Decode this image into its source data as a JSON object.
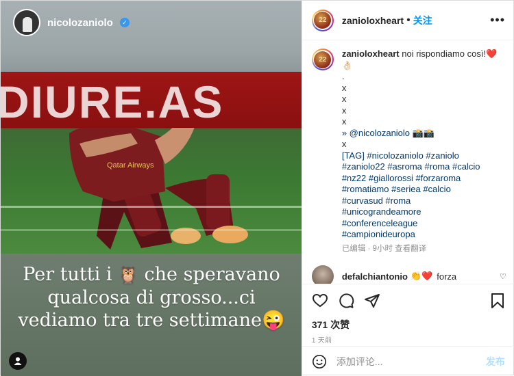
{
  "story": {
    "username": "nicolozaniolo",
    "banner_text": "DIURE.AS",
    "caption_line1_a": "Per tutti i ",
    "owl": "🦉",
    "caption_line1_b": " che speravano",
    "caption_line2": "qualcosa di grosso...ci",
    "caption_line3": "vediamo tra tre settimane",
    "wink_emoji": "😜"
  },
  "post": {
    "author": "zanioloxheart",
    "follow_label": "关注",
    "separator": "•",
    "more_label": "•••",
    "avatar_number": "22",
    "caption_text": "noi rispondiamo così!",
    "caption_emojis": "❤️👌🏻",
    "dots": [
      ".",
      "x",
      "x",
      "x",
      "x"
    ],
    "credit": "» @nicolozaniolo 📸📸",
    "credit_x": "x",
    "tags_line1": "[TAG] #nicolozaniolo #zaniolo",
    "tags_line2": "#zaniolo22 #asroma #roma #calcio",
    "tags_line3": "#nz22 #giallorossi #forzaroma",
    "tags_line4": "#romatiamo #seriea #calcio",
    "tags_line5": "#curvasud #roma",
    "tags_line6": "#unicograndeamore",
    "tags_line7": "#conferenceleague",
    "tags_line8": "#campionideuropa",
    "meta": "已编辑 · 9小时  查看翻译"
  },
  "comment": {
    "user": "defalchiantonio",
    "emojis": "👏❤️",
    "text": "forza"
  },
  "likes": "371 次赞",
  "date": "1 天前",
  "add_comment": {
    "placeholder": "添加评论...",
    "post_label": "发布"
  },
  "colors": {
    "link": "#0095f6",
    "hashtag": "#00376b",
    "muted": "#8e8e8e",
    "heart": "#ed4956"
  }
}
